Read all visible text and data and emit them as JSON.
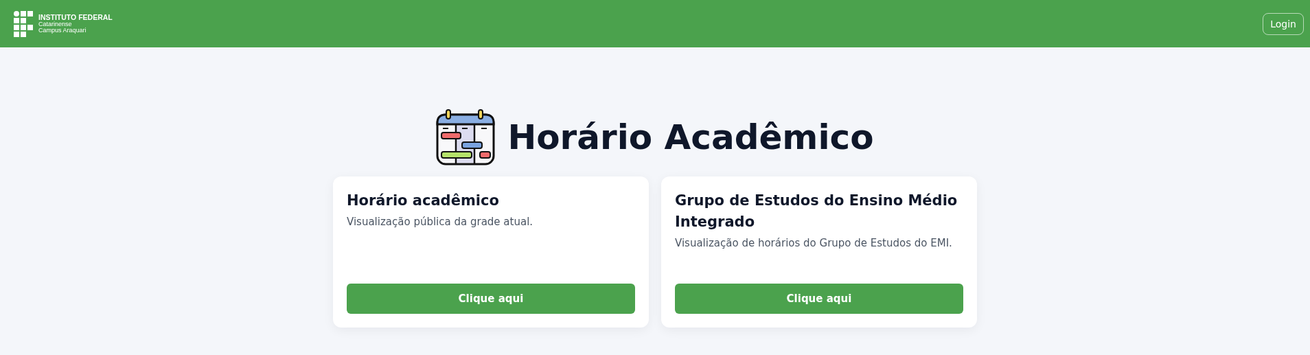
{
  "header": {
    "logo": {
      "name": "INSTITUTO FEDERAL",
      "line_1": "Catarinense",
      "line_2": "Campus Araquari"
    },
    "login_button": "Login"
  },
  "page_title": "Horário Acadêmico",
  "cards": [
    {
      "title": "Horário acadêmico",
      "description": "Visualização pública da grade atual.",
      "button": "Clique aqui"
    },
    {
      "title": "Grupo de Estudos do Ensino Médio Integrado",
      "description": "Visualização de horários do Grupo de Estudos do EMI.",
      "button": "Clique aqui"
    }
  ]
}
